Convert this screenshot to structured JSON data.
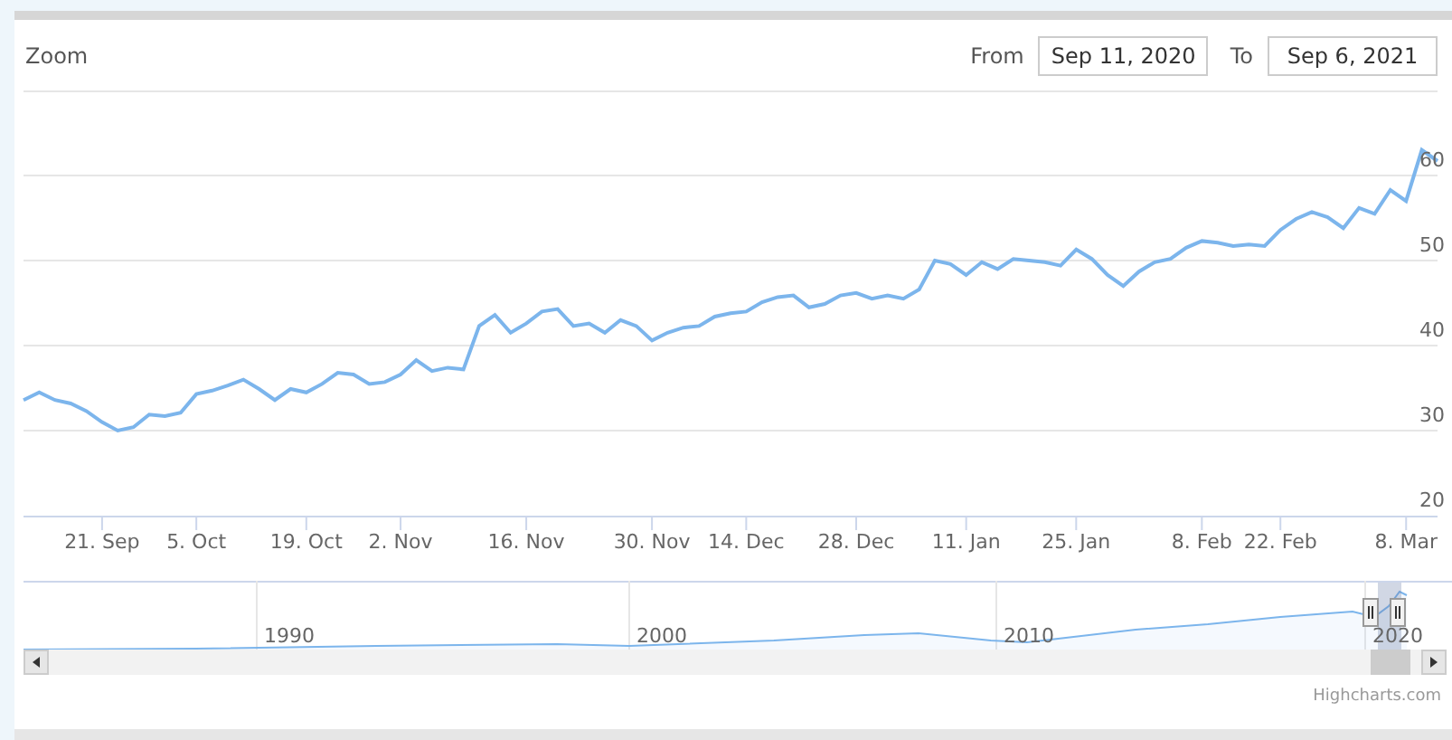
{
  "range_selector": {
    "zoom_label": "Zoom",
    "from_label": "From",
    "from_value": "Sep 11, 2020",
    "to_label": "To",
    "to_value": "Sep 6, 2021"
  },
  "chart": {
    "chart_data": {
      "type": "line",
      "categories": [
        null,
        null,
        null,
        null,
        null,
        "21. Sep",
        null,
        null,
        null,
        null,
        null,
        "5. Oct",
        null,
        null,
        null,
        null,
        null,
        null,
        "19. Oct",
        null,
        null,
        null,
        null,
        null,
        "2. Nov",
        null,
        null,
        null,
        null,
        null,
        null,
        null,
        "16. Nov",
        null,
        null,
        null,
        null,
        null,
        null,
        null,
        "30. Nov",
        null,
        null,
        null,
        null,
        null,
        "14. Dec",
        null,
        null,
        null,
        null,
        null,
        null,
        "28. Dec",
        null,
        null,
        null,
        null,
        null,
        null,
        "11. Jan",
        null,
        null,
        null,
        null,
        null,
        null,
        "25. Jan",
        null,
        null,
        null,
        null,
        null,
        null,
        null,
        "8. Feb",
        null,
        null,
        null,
        null,
        "22. Feb",
        null,
        null,
        null,
        null,
        null,
        null,
        null,
        "8. Mar",
        null,
        null
      ],
      "series": [
        {
          "color": "#7cb5ec",
          "values": [
            33.6,
            34.5,
            33.6,
            33.2,
            32.3,
            31,
            30,
            30.4,
            31.9,
            31.7,
            32.1,
            34.3,
            34.7,
            35.3,
            36,
            34.9,
            33.6,
            34.9,
            34.5,
            35.5,
            36.8,
            36.6,
            35.5,
            35.7,
            36.6,
            38.3,
            37,
            37.4,
            37.2,
            42.3,
            43.6,
            41.5,
            42.6,
            44,
            44.3,
            42.3,
            42.6,
            41.5,
            43,
            42.3,
            40.6,
            41.5,
            42.1,
            42.3,
            43.4,
            43.8,
            44,
            45.1,
            45.7,
            45.9,
            44.5,
            44.9,
            45.9,
            46.2,
            45.5,
            45.9,
            45.5,
            46.6,
            50,
            49.6,
            48.3,
            49.8,
            49,
            50.2,
            50,
            49.8,
            49.4,
            51.3,
            50.2,
            48.3,
            47,
            48.7,
            49.8,
            50.2,
            51.5,
            52.3,
            52.1,
            51.7,
            51.9,
            51.7,
            53.6,
            54.9,
            55.7,
            55.1,
            53.8,
            56.2,
            55.5,
            58.3,
            57,
            63,
            61.7
          ]
        }
      ],
      "ylim": [
        20,
        70
      ],
      "yticks": [
        20,
        30,
        40,
        50,
        60
      ],
      "grid": true
    }
  },
  "navigator": {
    "year_labels": [
      "1990",
      "2000",
      "2010",
      "2020"
    ]
  },
  "credits": "Highcharts.com"
}
